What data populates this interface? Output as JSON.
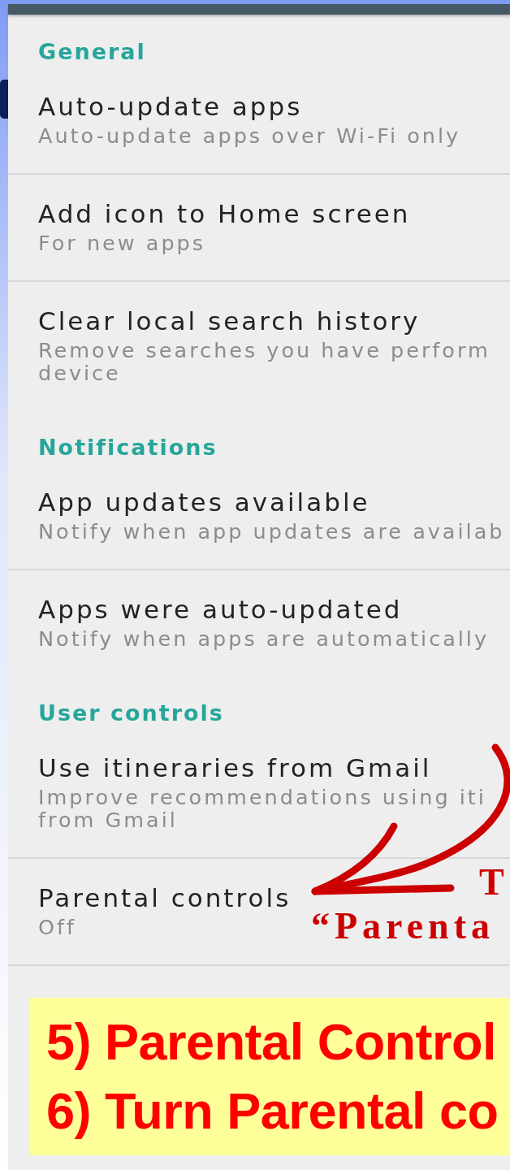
{
  "sections": [
    {
      "title": "General",
      "items": [
        {
          "title": "Auto-update apps",
          "summary": [
            "Auto-update apps over Wi-Fi only"
          ]
        },
        {
          "title": "Add icon to Home screen",
          "summary": [
            "For new apps"
          ]
        },
        {
          "title": "Clear local search history",
          "summary": [
            "Remove searches you have perform",
            "device"
          ]
        }
      ]
    },
    {
      "title": "Notifications",
      "items": [
        {
          "title": "App updates available",
          "summary": [
            "Notify when app updates are availab"
          ]
        },
        {
          "title": "Apps were auto-updated",
          "summary": [
            "Notify when apps are automatically"
          ]
        }
      ]
    },
    {
      "title": "User controls",
      "items": [
        {
          "title": "Use itineraries from Gmail",
          "summary": [
            "Improve recommendations using iti",
            "from Gmail"
          ]
        },
        {
          "title": "Parental controls",
          "summary": [
            "Off"
          ]
        }
      ]
    }
  ],
  "annotation": {
    "lines": [
      "T",
      "“Parenta"
    ]
  },
  "caption": {
    "lines": [
      "5) Parental Control",
      "6) Turn Parental co"
    ]
  }
}
